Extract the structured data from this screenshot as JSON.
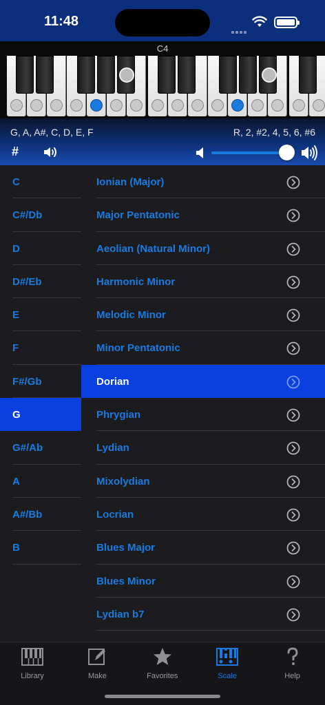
{
  "status": {
    "time": "11:48"
  },
  "keyboard": {
    "octave_label": "C4"
  },
  "info": {
    "notes": "G, A, A#, C, D, E, F",
    "intervals": "R, 2, #2, 4, 5, 6, #6",
    "sharp_label": "#",
    "volume_level": 0.92
  },
  "keys": [
    {
      "label": "C"
    },
    {
      "label": "C#/Db"
    },
    {
      "label": "D"
    },
    {
      "label": "D#/Eb"
    },
    {
      "label": "E"
    },
    {
      "label": "F"
    },
    {
      "label": "F#/Gb"
    },
    {
      "label": "G",
      "selected": true
    },
    {
      "label": "G#/Ab"
    },
    {
      "label": "A"
    },
    {
      "label": "A#/Bb"
    },
    {
      "label": "B"
    }
  ],
  "scales": [
    {
      "label": "Ionian (Major)"
    },
    {
      "label": "Major Pentatonic"
    },
    {
      "label": "Aeolian (Natural Minor)"
    },
    {
      "label": "Harmonic Minor"
    },
    {
      "label": "Melodic Minor"
    },
    {
      "label": "Minor Pentatonic"
    },
    {
      "label": "Dorian",
      "selected": true
    },
    {
      "label": "Phrygian"
    },
    {
      "label": "Lydian"
    },
    {
      "label": "Mixolydian"
    },
    {
      "label": "Locrian"
    },
    {
      "label": "Blues Major"
    },
    {
      "label": "Blues Minor"
    },
    {
      "label": "Lydian b7"
    }
  ],
  "tabs": [
    {
      "label": "Library",
      "icon": "library-icon"
    },
    {
      "label": "Make",
      "icon": "pencil-icon"
    },
    {
      "label": "Favorites",
      "icon": "star-icon"
    },
    {
      "label": "Scale",
      "icon": "scale-icon",
      "active": true
    },
    {
      "label": "Help",
      "icon": "question-icon"
    }
  ],
  "colors": {
    "accent": "#1a7ae0",
    "selected_bg": "#0a3fe0",
    "header": "#0c2f7d"
  }
}
